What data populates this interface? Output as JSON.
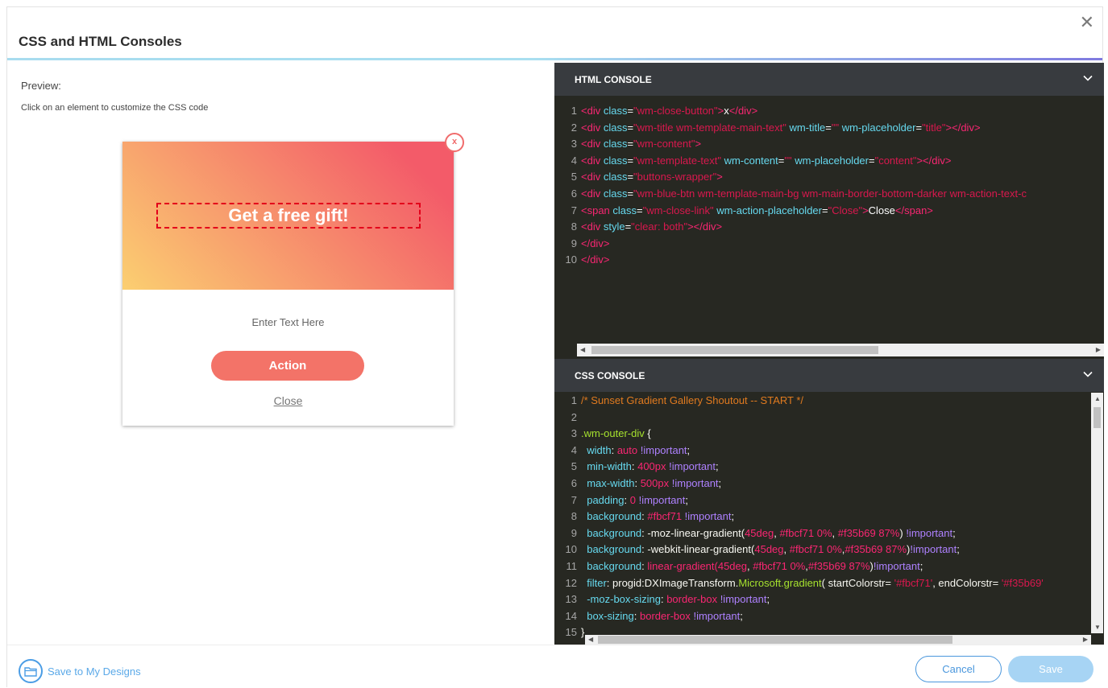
{
  "modal": {
    "title": "CSS and HTML Consoles",
    "close_glyph": "✕"
  },
  "preview": {
    "label": "Preview:",
    "hint": "Click on an element to customize the CSS code",
    "popup": {
      "title": "Get a free gift!",
      "close_glyph": "x",
      "text": "Enter Text Here",
      "action_label": "Action",
      "close_link": "Close",
      "gradient_start": "#fbcf71",
      "gradient_end": "#f35b69"
    }
  },
  "html_console": {
    "label": "HTML CONSOLE",
    "lines": [
      [
        {
          "t": "<div ",
          "c": "c-tag"
        },
        {
          "t": "class",
          "c": "c-attr"
        },
        {
          "t": "=",
          "c": "c-txt"
        },
        {
          "t": "\"wm-close-button\"",
          "c": "c-str"
        },
        {
          "t": ">",
          "c": "c-tag"
        },
        {
          "t": "x",
          "c": "c-txt"
        },
        {
          "t": "</div>",
          "c": "c-tag"
        }
      ],
      [
        {
          "t": "<div ",
          "c": "c-tag"
        },
        {
          "t": "class",
          "c": "c-attr"
        },
        {
          "t": "=",
          "c": "c-txt"
        },
        {
          "t": "\"wm-title wm-template-main-text\"",
          "c": "c-str"
        },
        {
          "t": " wm-title",
          "c": "c-attr"
        },
        {
          "t": "=",
          "c": "c-txt"
        },
        {
          "t": "\"\"",
          "c": "c-str"
        },
        {
          "t": " wm-placeholder",
          "c": "c-attr"
        },
        {
          "t": "=",
          "c": "c-txt"
        },
        {
          "t": "\"title\"",
          "c": "c-str"
        },
        {
          "t": "></div>",
          "c": "c-tag"
        }
      ],
      [
        {
          "t": "<div ",
          "c": "c-tag"
        },
        {
          "t": "class",
          "c": "c-attr"
        },
        {
          "t": "=",
          "c": "c-txt"
        },
        {
          "t": "\"wm-content\"",
          "c": "c-str"
        },
        {
          "t": ">",
          "c": "c-tag"
        }
      ],
      [
        {
          "t": "<div ",
          "c": "c-tag"
        },
        {
          "t": "class",
          "c": "c-attr"
        },
        {
          "t": "=",
          "c": "c-txt"
        },
        {
          "t": "\"wm-template-text\"",
          "c": "c-str"
        },
        {
          "t": " wm-content",
          "c": "c-attr"
        },
        {
          "t": "=",
          "c": "c-txt"
        },
        {
          "t": "\"\"",
          "c": "c-str"
        },
        {
          "t": " wm-placeholder",
          "c": "c-attr"
        },
        {
          "t": "=",
          "c": "c-txt"
        },
        {
          "t": "\"content\"",
          "c": "c-str"
        },
        {
          "t": "></div>",
          "c": "c-tag"
        }
      ],
      [
        {
          "t": "<div ",
          "c": "c-tag"
        },
        {
          "t": "class",
          "c": "c-attr"
        },
        {
          "t": "=",
          "c": "c-txt"
        },
        {
          "t": "\"buttons-wrapper\"",
          "c": "c-str"
        },
        {
          "t": ">",
          "c": "c-tag"
        }
      ],
      [
        {
          "t": "<div ",
          "c": "c-tag"
        },
        {
          "t": "class",
          "c": "c-attr"
        },
        {
          "t": "=",
          "c": "c-txt"
        },
        {
          "t": "\"wm-blue-btn wm-template-main-bg wm-main-border-bottom-darker wm-action-text-c",
          "c": "c-str"
        }
      ],
      [
        {
          "t": "<span ",
          "c": "c-tag"
        },
        {
          "t": "class",
          "c": "c-attr"
        },
        {
          "t": "=",
          "c": "c-txt"
        },
        {
          "t": "\"wm-close-link\"",
          "c": "c-str"
        },
        {
          "t": " wm-action-placeholder",
          "c": "c-attr"
        },
        {
          "t": "=",
          "c": "c-txt"
        },
        {
          "t": "\"Close\"",
          "c": "c-str"
        },
        {
          "t": ">",
          "c": "c-tag"
        },
        {
          "t": "Close",
          "c": "c-txt"
        },
        {
          "t": "</span>",
          "c": "c-tag"
        }
      ],
      [
        {
          "t": "<div ",
          "c": "c-tag"
        },
        {
          "t": "style",
          "c": "c-attr"
        },
        {
          "t": "=",
          "c": "c-txt"
        },
        {
          "t": "\"clear: both\"",
          "c": "c-str"
        },
        {
          "t": "></div>",
          "c": "c-tag"
        }
      ],
      [
        {
          "t": "</div>",
          "c": "c-tag"
        }
      ],
      [
        {
          "t": "</div>",
          "c": "c-tag"
        }
      ]
    ]
  },
  "css_console": {
    "label": "CSS CONSOLE",
    "lines": [
      [
        {
          "t": "/* Sunset Gradient Gallery Shoutout -- START */",
          "c": "c-com"
        }
      ],
      [],
      [
        {
          "t": ".wm-outer-div ",
          "c": "c-sel"
        },
        {
          "t": "{",
          "c": "c-plain"
        }
      ],
      [
        {
          "t": "  width",
          "c": "c-prop"
        },
        {
          "t": ": ",
          "c": "c-plain"
        },
        {
          "t": "auto",
          "c": "c-val"
        },
        {
          "t": " !important",
          "c": "c-imp"
        },
        {
          "t": ";",
          "c": "c-plain"
        }
      ],
      [
        {
          "t": "  min-width",
          "c": "c-prop"
        },
        {
          "t": ": ",
          "c": "c-plain"
        },
        {
          "t": "400px",
          "c": "c-val"
        },
        {
          "t": " !important",
          "c": "c-imp"
        },
        {
          "t": ";",
          "c": "c-plain"
        }
      ],
      [
        {
          "t": "  max-width",
          "c": "c-prop"
        },
        {
          "t": ": ",
          "c": "c-plain"
        },
        {
          "t": "500px",
          "c": "c-val"
        },
        {
          "t": " !important",
          "c": "c-imp"
        },
        {
          "t": ";",
          "c": "c-plain"
        }
      ],
      [
        {
          "t": "  padding",
          "c": "c-prop"
        },
        {
          "t": ": ",
          "c": "c-plain"
        },
        {
          "t": "0",
          "c": "c-val"
        },
        {
          "t": " !important",
          "c": "c-imp"
        },
        {
          "t": ";",
          "c": "c-plain"
        }
      ],
      [
        {
          "t": "  background",
          "c": "c-prop"
        },
        {
          "t": ": ",
          "c": "c-plain"
        },
        {
          "t": "#fbcf71",
          "c": "c-val"
        },
        {
          "t": " !important",
          "c": "c-imp"
        },
        {
          "t": ";",
          "c": "c-plain"
        }
      ],
      [
        {
          "t": "  background",
          "c": "c-prop"
        },
        {
          "t": ": ",
          "c": "c-plain"
        },
        {
          "t": "-moz-linear-gradient(",
          "c": "c-plain"
        },
        {
          "t": "45deg",
          "c": "c-val"
        },
        {
          "t": ", ",
          "c": "c-plain"
        },
        {
          "t": "#fbcf71 0%",
          "c": "c-val"
        },
        {
          "t": ", ",
          "c": "c-plain"
        },
        {
          "t": "#f35b69 87%",
          "c": "c-val"
        },
        {
          "t": ")",
          "c": "c-plain"
        },
        {
          "t": " !important",
          "c": "c-imp"
        },
        {
          "t": ";",
          "c": "c-plain"
        }
      ],
      [
        {
          "t": "  background",
          "c": "c-prop"
        },
        {
          "t": ": ",
          "c": "c-plain"
        },
        {
          "t": "-webkit-linear-gradient(",
          "c": "c-plain"
        },
        {
          "t": "45deg",
          "c": "c-val"
        },
        {
          "t": ", ",
          "c": "c-plain"
        },
        {
          "t": "#fbcf71 0%",
          "c": "c-val"
        },
        {
          "t": ",",
          "c": "c-plain"
        },
        {
          "t": "#f35b69 87%",
          "c": "c-val"
        },
        {
          "t": ")",
          "c": "c-plain"
        },
        {
          "t": "!important",
          "c": "c-imp"
        },
        {
          "t": ";",
          "c": "c-plain"
        }
      ],
      [
        {
          "t": "  background",
          "c": "c-prop"
        },
        {
          "t": ": ",
          "c": "c-plain"
        },
        {
          "t": "linear-gradient(",
          "c": "c-val"
        },
        {
          "t": "45deg",
          "c": "c-val"
        },
        {
          "t": ", ",
          "c": "c-plain"
        },
        {
          "t": "#fbcf71 0%",
          "c": "c-val"
        },
        {
          "t": ",",
          "c": "c-plain"
        },
        {
          "t": "#f35b69 87%",
          "c": "c-val"
        },
        {
          "t": ")",
          "c": "c-plain"
        },
        {
          "t": "!important",
          "c": "c-imp"
        },
        {
          "t": ";",
          "c": "c-plain"
        }
      ],
      [
        {
          "t": "  filter",
          "c": "c-prop"
        },
        {
          "t": ": progid:DXImageTransform.",
          "c": "c-plain"
        },
        {
          "t": "Microsoft.gradient",
          "c": "c-fn"
        },
        {
          "t": "( startColorstr= ",
          "c": "c-plain"
        },
        {
          "t": "'#fbcf71'",
          "c": "c-str"
        },
        {
          "t": ", endColorstr= ",
          "c": "c-plain"
        },
        {
          "t": "'#f35b69'",
          "c": "c-str"
        }
      ],
      [
        {
          "t": "  -moz-box-sizing",
          "c": "c-prop"
        },
        {
          "t": ": ",
          "c": "c-plain"
        },
        {
          "t": "border-box",
          "c": "c-val"
        },
        {
          "t": " !important",
          "c": "c-imp"
        },
        {
          "t": ";",
          "c": "c-plain"
        }
      ],
      [
        {
          "t": "  box-sizing",
          "c": "c-prop"
        },
        {
          "t": ": ",
          "c": "c-plain"
        },
        {
          "t": "border-box",
          "c": "c-val"
        },
        {
          "t": " !important",
          "c": "c-imp"
        },
        {
          "t": ";",
          "c": "c-plain"
        }
      ],
      [
        {
          "t": "}",
          "c": "c-plain"
        }
      ],
      []
    ]
  },
  "footer": {
    "save_designs_label": "Save to My Designs",
    "cancel_label": "Cancel",
    "save_label": "Save"
  },
  "colors": {
    "accent": "#4a97dd",
    "save_disabled": "#a7d4f4",
    "action_button": "#f37368",
    "editor_bg": "#272822",
    "console_header": "#383b3f"
  },
  "icons": {
    "close": "close-icon",
    "chevron": "chevron-down-icon",
    "folder": "folder-icon"
  }
}
